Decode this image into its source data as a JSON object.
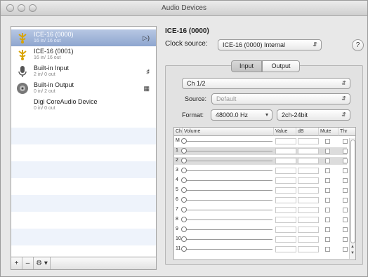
{
  "window": {
    "title": "Audio Devices"
  },
  "devices": [
    {
      "name": "ICE-16 (0000)",
      "sub": "16 in/ 16 out",
      "icon": "usb-device-icon",
      "right": "speaker-icon",
      "selected": true
    },
    {
      "name": "ICE-16 (0001)",
      "sub": "16 in/ 16 out",
      "icon": "usb-device-icon",
      "right": "",
      "selected": false
    },
    {
      "name": "Built-in Input",
      "sub": "2 in/ 0 out",
      "icon": "microphone-device-icon",
      "right": "mic-icon",
      "selected": false
    },
    {
      "name": "Built-in Output",
      "sub": "0 in/ 2 out",
      "icon": "speaker-device-icon",
      "right": "alert-icon",
      "selected": false
    },
    {
      "name": "Digi CoreAudio Device",
      "sub": "0 in/ 0 out",
      "icon": "",
      "right": "",
      "selected": false
    }
  ],
  "bottom_bar": {
    "add": "+",
    "remove": "–",
    "action": "⚙ ▾"
  },
  "device_title": "ICE-16 (0000)",
  "clock": {
    "label": "Clock source:",
    "value": "ICE-16 (0000) Internal"
  },
  "help": "?",
  "tabs": {
    "input": "Input",
    "output": "Output",
    "active": "input"
  },
  "channel_popup": "Ch 1/2",
  "source": {
    "label": "Source:",
    "value": "Default"
  },
  "format": {
    "label": "Format:",
    "rate": "48000.0 Hz",
    "layout": "2ch-24bit"
  },
  "grid": {
    "headers": [
      "Ch",
      "Volume",
      "Value",
      "dB",
      "Mute",
      "Thr"
    ],
    "rows": [
      {
        "ch": "M",
        "highlight": false
      },
      {
        "ch": "1",
        "highlight": true
      },
      {
        "ch": "2",
        "highlight": true
      },
      {
        "ch": "3",
        "highlight": false
      },
      {
        "ch": "4",
        "highlight": false
      },
      {
        "ch": "5",
        "highlight": false
      },
      {
        "ch": "6",
        "highlight": false
      },
      {
        "ch": "7",
        "highlight": false
      },
      {
        "ch": "8",
        "highlight": false
      },
      {
        "ch": "9",
        "highlight": false
      },
      {
        "ch": "10",
        "highlight": false
      },
      {
        "ch": "11",
        "highlight": false
      }
    ]
  },
  "colors": {
    "selection": "#8ea6cf",
    "stripe": "#eef3fb"
  }
}
